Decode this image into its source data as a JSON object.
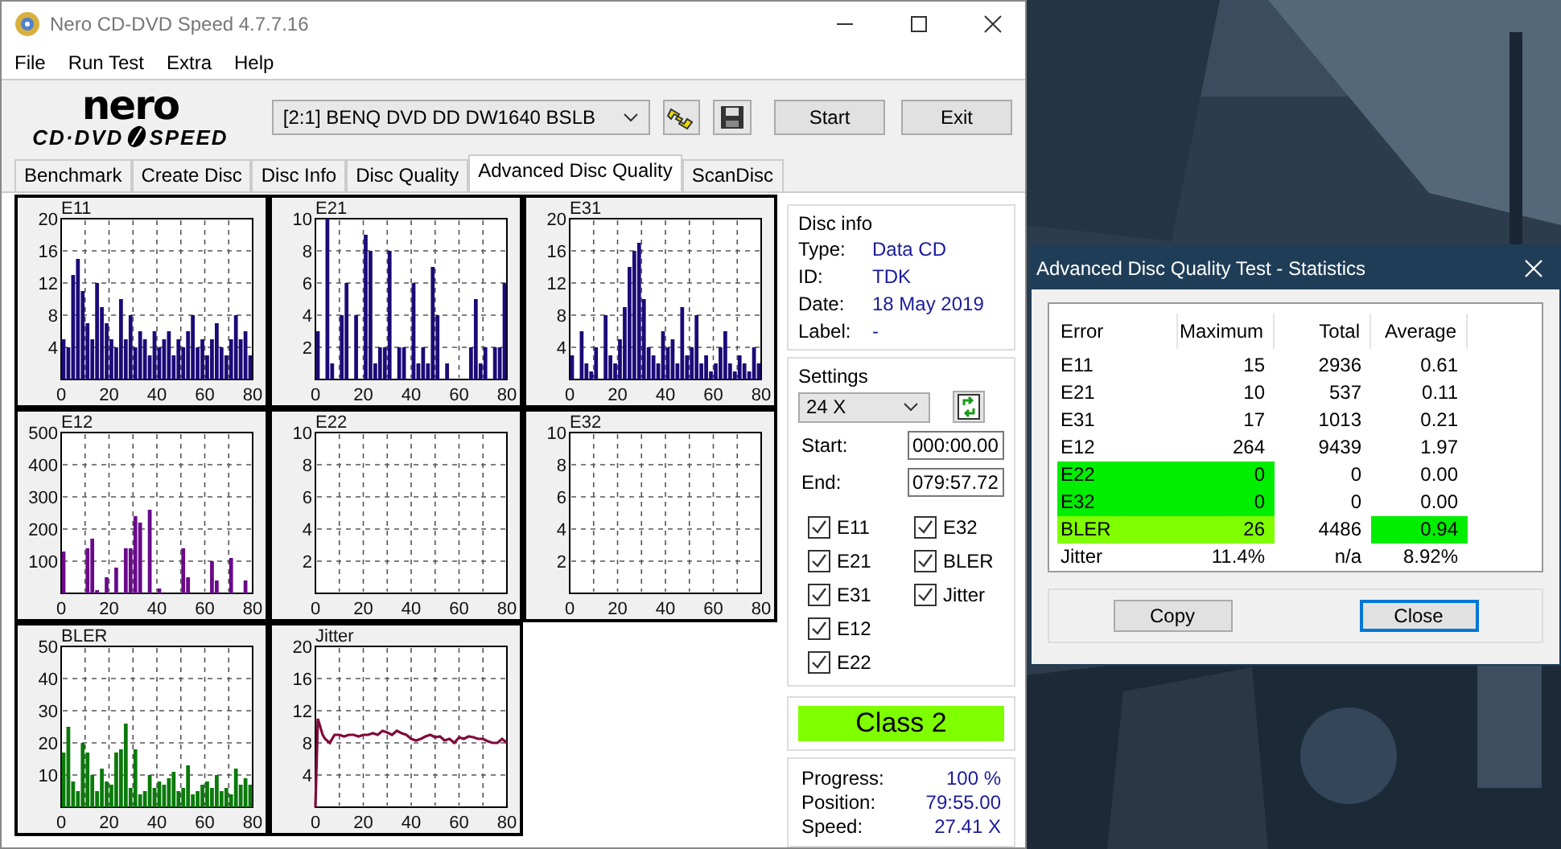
{
  "window": {
    "title": "Nero CD-DVD Speed 4.7.7.16"
  },
  "menu": [
    "File",
    "Run Test",
    "Extra",
    "Help"
  ],
  "logo": {
    "top": "nero",
    "bottom_left": "CD·DVD",
    "bottom_right": "SPEED"
  },
  "drive": {
    "value": "[2:1]   BENQ DVD DD DW1640 BSLB"
  },
  "buttons": [
    "Start",
    "Exit"
  ],
  "tabs": [
    {
      "label": "Benchmark",
      "selected": false
    },
    {
      "label": "Create Disc",
      "selected": false
    },
    {
      "label": "Disc Info",
      "selected": false
    },
    {
      "label": "Disc Quality",
      "selected": false
    },
    {
      "label": "Advanced Disc Quality",
      "selected": true
    },
    {
      "label": "ScanDisc",
      "selected": false
    }
  ],
  "charts": [
    {
      "chart_data": {
        "type": "bar",
        "title": "E11",
        "grid": true,
        "xlim": [
          0,
          80
        ],
        "ylim": [
          0,
          20
        ],
        "xticks": [
          0,
          20,
          40,
          60,
          80
        ],
        "yticks": [
          4,
          8,
          12,
          16,
          20
        ],
        "x": [
          1,
          3,
          5,
          7,
          9,
          11,
          13,
          15,
          17,
          19,
          21,
          23,
          25,
          27,
          29,
          31,
          33,
          35,
          37,
          39,
          41,
          43,
          45,
          47,
          49,
          51,
          53,
          55,
          57,
          59,
          61,
          63,
          65,
          67,
          69,
          71,
          73,
          75,
          77,
          79
        ],
        "series": [
          {
            "color": "#1c0a78",
            "values": [
              5,
              4,
              13,
              15,
              11,
              7,
              5,
              12,
              9,
              7,
              5,
              4,
              10,
              5,
              8,
              4,
              6,
              5,
              3,
              6,
              4,
              5,
              6,
              3,
              5,
              4,
              6,
              8,
              4,
              5,
              3,
              5,
              7,
              4,
              3,
              5,
              8,
              5,
              6,
              3
            ]
          }
        ]
      }
    },
    {
      "chart_data": {
        "type": "bar",
        "title": "E21",
        "grid": true,
        "xlim": [
          0,
          80
        ],
        "ylim": [
          0,
          10
        ],
        "xticks": [
          0,
          20,
          40,
          60,
          80
        ],
        "yticks": [
          2,
          4,
          6,
          8,
          10
        ],
        "x": [
          1,
          3,
          5,
          7,
          9,
          11,
          13,
          15,
          17,
          19,
          21,
          23,
          25,
          27,
          29,
          31,
          33,
          35,
          37,
          39,
          41,
          43,
          45,
          47,
          49,
          51,
          53,
          55,
          57,
          59,
          61,
          63,
          65,
          67,
          69,
          71,
          73,
          75,
          77,
          79
        ],
        "series": [
          {
            "color": "#1c0a78",
            "values": [
              3,
              0,
              10,
              1,
              0,
              4,
              6,
              0,
              4,
              0,
              9,
              8,
              1,
              2,
              2,
              8,
              0,
              2,
              2,
              0,
              6,
              1,
              2,
              1,
              7,
              4,
              0,
              1,
              0,
              0,
              0,
              0,
              2,
              5,
              1,
              2,
              0,
              2,
              2,
              6
            ]
          }
        ]
      }
    },
    {
      "chart_data": {
        "type": "bar",
        "title": "E31",
        "grid": true,
        "xlim": [
          0,
          80
        ],
        "ylim": [
          0,
          20
        ],
        "xticks": [
          0,
          20,
          40,
          60,
          80
        ],
        "yticks": [
          4,
          8,
          12,
          16,
          20
        ],
        "x": [
          1,
          3,
          5,
          7,
          9,
          11,
          13,
          15,
          17,
          19,
          21,
          23,
          25,
          27,
          29,
          31,
          33,
          35,
          37,
          39,
          41,
          43,
          45,
          47,
          49,
          51,
          53,
          55,
          57,
          59,
          61,
          63,
          65,
          67,
          69,
          71,
          73,
          75,
          77,
          79
        ],
        "series": [
          {
            "color": "#1c0a78",
            "values": [
              3,
              0,
              6,
              2,
              1,
              4,
              0,
              8,
              3,
              2,
              5,
              9,
              14,
              16,
              17,
              10,
              4,
              3,
              2,
              6,
              4,
              5,
              2,
              9,
              3,
              4,
              8,
              2,
              3,
              1,
              2,
              4,
              6,
              2,
              1,
              3,
              2,
              1,
              4,
              2
            ]
          }
        ]
      }
    },
    {
      "chart_data": {
        "type": "bar",
        "title": "E12",
        "grid": true,
        "xlim": [
          0,
          80
        ],
        "ylim": [
          0,
          500
        ],
        "xticks": [
          0,
          20,
          40,
          60,
          80
        ],
        "yticks": [
          100,
          200,
          300,
          400,
          500
        ],
        "x": [
          1,
          3,
          5,
          7,
          9,
          11,
          13,
          15,
          17,
          19,
          21,
          23,
          25,
          27,
          29,
          31,
          33,
          35,
          37,
          39,
          41,
          43,
          45,
          47,
          49,
          51,
          53,
          55,
          57,
          59,
          61,
          63,
          65,
          67,
          69,
          71,
          73,
          75,
          77,
          79
        ],
        "series": [
          {
            "color": "#6a0a8a",
            "values": [
              130,
              0,
              0,
              0,
              0,
              140,
              170,
              10,
              0,
              50,
              0,
              80,
              0,
              140,
              140,
              240,
              220,
              0,
              260,
              0,
              15,
              0,
              0,
              0,
              0,
              140,
              50,
              0,
              0,
              0,
              0,
              100,
              40,
              0,
              0,
              110,
              0,
              0,
              40,
              0
            ]
          }
        ]
      }
    },
    {
      "chart_data": {
        "type": "bar",
        "title": "E22",
        "grid": true,
        "xlim": [
          0,
          80
        ],
        "ylim": [
          0,
          10
        ],
        "xticks": [
          0,
          20,
          40,
          60,
          80
        ],
        "yticks": [
          2,
          4,
          6,
          8,
          10
        ],
        "x": [
          1,
          3,
          5,
          7,
          9,
          11,
          13,
          15,
          17,
          19,
          21,
          23,
          25,
          27,
          29,
          31,
          33,
          35,
          37,
          39,
          41,
          43,
          45,
          47,
          49,
          51,
          53,
          55,
          57,
          59,
          61,
          63,
          65,
          67,
          69,
          71,
          73,
          75,
          77,
          79
        ],
        "series": [
          {
            "values": [
              0,
              0,
              0,
              0,
              0,
              0,
              0,
              0,
              0,
              0,
              0,
              0,
              0,
              0,
              0,
              0,
              0,
              0,
              0,
              0,
              0,
              0,
              0,
              0,
              0,
              0,
              0,
              0,
              0,
              0,
              0,
              0,
              0,
              0,
              0,
              0,
              0,
              0,
              0,
              0
            ]
          }
        ]
      }
    },
    {
      "chart_data": {
        "type": "bar",
        "title": "E32",
        "grid": true,
        "xlim": [
          0,
          80
        ],
        "ylim": [
          0,
          10
        ],
        "xticks": [
          0,
          20,
          40,
          60,
          80
        ],
        "yticks": [
          2,
          4,
          6,
          8,
          10
        ],
        "x": [
          1,
          3,
          5,
          7,
          9,
          11,
          13,
          15,
          17,
          19,
          21,
          23,
          25,
          27,
          29,
          31,
          33,
          35,
          37,
          39,
          41,
          43,
          45,
          47,
          49,
          51,
          53,
          55,
          57,
          59,
          61,
          63,
          65,
          67,
          69,
          71,
          73,
          75,
          77,
          79
        ],
        "series": [
          {
            "values": [
              0,
              0,
              0,
              0,
              0,
              0,
              0,
              0,
              0,
              0,
              0,
              0,
              0,
              0,
              0,
              0,
              0,
              0,
              0,
              0,
              0,
              0,
              0,
              0,
              0,
              0,
              0,
              0,
              0,
              0,
              0,
              0,
              0,
              0,
              0,
              0,
              0,
              0,
              0,
              0
            ]
          }
        ]
      }
    },
    {
      "chart_data": {
        "type": "bar",
        "title": "BLER",
        "grid": true,
        "xlim": [
          0,
          80
        ],
        "ylim": [
          0,
          50
        ],
        "xticks": [
          0,
          20,
          40,
          60,
          80
        ],
        "yticks": [
          10,
          20,
          30,
          40,
          50
        ],
        "x": [
          1,
          3,
          5,
          7,
          9,
          11,
          13,
          15,
          17,
          19,
          21,
          23,
          25,
          27,
          29,
          31,
          33,
          35,
          37,
          39,
          41,
          43,
          45,
          47,
          49,
          51,
          53,
          55,
          57,
          59,
          61,
          63,
          65,
          67,
          69,
          71,
          73,
          75,
          77,
          79
        ],
        "series": [
          {
            "color": "#0a7a0a",
            "values": [
              17,
              25,
              8,
              5,
              20,
              17,
              10,
              5,
              12,
              8,
              7,
              17,
              18,
              26,
              6,
              18,
              4,
              5,
              10,
              6,
              8,
              7,
              9,
              11,
              5,
              6,
              13,
              4,
              5,
              7,
              8,
              6,
              10,
              5,
              6,
              4,
              12,
              7,
              9,
              7
            ]
          }
        ]
      }
    },
    {
      "chart_data": {
        "type": "line",
        "title": "Jitter",
        "grid": true,
        "xlim": [
          0,
          80
        ],
        "ylim": [
          0,
          20
        ],
        "xticks": [
          0,
          20,
          40,
          60,
          80
        ],
        "yticks": [
          4,
          8,
          12,
          16,
          20
        ],
        "x": [
          0,
          1,
          2,
          3,
          4,
          6,
          8,
          10,
          12,
          14,
          16,
          18,
          20,
          22,
          24,
          26,
          28,
          30,
          32,
          34,
          36,
          38,
          40,
          42,
          44,
          46,
          48,
          50,
          52,
          54,
          56,
          58,
          60,
          62,
          64,
          66,
          68,
          70,
          72,
          74,
          76,
          78,
          80
        ],
        "series": [
          {
            "color": "#800a3a",
            "values": [
              0,
              11,
              10,
              9,
              8.5,
              8,
              9,
              9,
              8.8,
              9,
              9,
              8.8,
              9,
              9,
              9.2,
              9,
              9.5,
              9.3,
              9,
              9.5,
              9.2,
              9,
              8.5,
              8.3,
              8.5,
              8.8,
              9,
              8.7,
              8.8,
              8.3,
              8.5,
              8,
              8.7,
              8.5,
              8.8,
              8.7,
              8.5,
              8.5,
              8.2,
              8,
              8,
              8.5,
              8
            ]
          }
        ]
      }
    }
  ],
  "disc_info": {
    "title": "Disc info",
    "rows": [
      {
        "label": "Type:",
        "value": "Data CD"
      },
      {
        "label": "ID:",
        "value": "TDK"
      },
      {
        "label": "Date:",
        "value": "18 May 2019"
      },
      {
        "label": "Label:",
        "value": "-"
      }
    ]
  },
  "settings": {
    "title": "Settings",
    "speed": "24 X",
    "start_label": "Start:",
    "start": "000:00.00",
    "end_label": "End:",
    "end": "079:57.72",
    "checks": [
      {
        "label": "E11",
        "checked": true
      },
      {
        "label": "E21",
        "checked": true
      },
      {
        "label": "E31",
        "checked": true
      },
      {
        "label": "E12",
        "checked": true
      },
      {
        "label": "E22",
        "checked": true
      },
      {
        "label": "E32",
        "checked": true
      },
      {
        "label": "BLER",
        "checked": true
      },
      {
        "label": "Jitter",
        "checked": true
      }
    ]
  },
  "class_badge": {
    "text": "Class 2",
    "color": "#80ff00"
  },
  "progress": [
    {
      "label": "Progress:",
      "value": "100 %"
    },
    {
      "label": "Position:",
      "value": "79:55.00"
    },
    {
      "label": "Speed:",
      "value": "27.41 X"
    }
  ],
  "dialog": {
    "title": "Advanced Disc Quality Test - Statistics",
    "columns": [
      "Error",
      "Maximum",
      "Total",
      "Average"
    ],
    "rows": [
      {
        "cells": [
          {
            "text": "E11"
          },
          {
            "text": "15"
          },
          {
            "text": "2936"
          },
          {
            "text": "0.61"
          }
        ]
      },
      {
        "cells": [
          {
            "text": "E21"
          },
          {
            "text": "10"
          },
          {
            "text": "537"
          },
          {
            "text": "0.11"
          }
        ]
      },
      {
        "cells": [
          {
            "text": "E31"
          },
          {
            "text": "17"
          },
          {
            "text": "1013"
          },
          {
            "text": "0.21"
          }
        ]
      },
      {
        "cells": [
          {
            "text": "E12"
          },
          {
            "text": "264"
          },
          {
            "text": "9439"
          },
          {
            "text": "1.97"
          }
        ]
      },
      {
        "cells": [
          {
            "text": "E22",
            "color": "#00ee00"
          },
          {
            "text": "0",
            "color": "#00ee00"
          },
          {
            "text": "0"
          },
          {
            "text": "0.00"
          }
        ]
      },
      {
        "cells": [
          {
            "text": "E32",
            "color": "#00ee00"
          },
          {
            "text": "0",
            "color": "#00ee00"
          },
          {
            "text": "0"
          },
          {
            "text": "0.00"
          }
        ]
      },
      {
        "cells": [
          {
            "text": "BLER",
            "color": "#80ff00"
          },
          {
            "text": "26",
            "color": "#80ff00"
          },
          {
            "text": "4486"
          },
          {
            "text": "0.94",
            "color": "#00ee00"
          }
        ]
      },
      {
        "cells": [
          {
            "text": "Jitter"
          },
          {
            "text": "11.4%"
          },
          {
            "text": "n/a"
          },
          {
            "text": "8.92%"
          }
        ]
      }
    ],
    "buttons": [
      {
        "label": "Copy",
        "focused": false
      },
      {
        "label": "Close",
        "focused": true
      }
    ]
  }
}
